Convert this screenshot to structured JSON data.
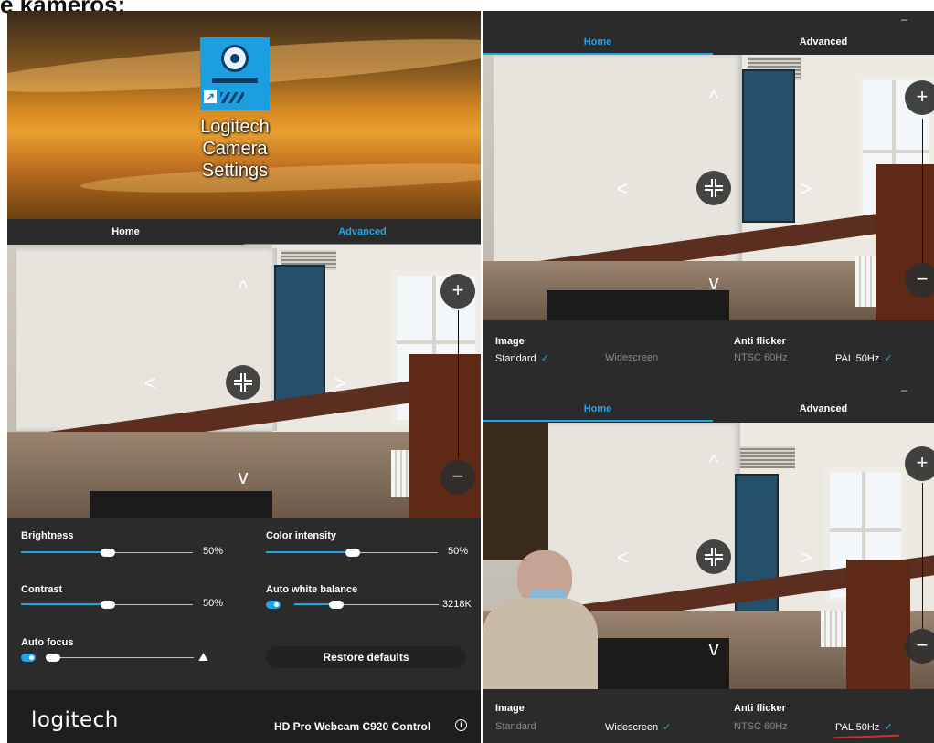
{
  "heading": "e kameros:",
  "desktop": {
    "icon_label": "Logitech Camera Settings"
  },
  "tabs": {
    "home": "Home",
    "advanced": "Advanced"
  },
  "controls": {
    "brightness": {
      "label": "Brightness",
      "value": "50%",
      "level": 0.5
    },
    "contrast": {
      "label": "Contrast",
      "value": "50%",
      "level": 0.5
    },
    "auto_focus": {
      "label": "Auto focus",
      "enabled": true
    },
    "color_intensity": {
      "label": "Color intensity",
      "value": "50%",
      "level": 0.5
    },
    "auto_white_balance": {
      "label": "Auto white balance",
      "value": "3218K",
      "enabled": true,
      "level": 0.3
    },
    "restore_label": "Restore defaults"
  },
  "footer": {
    "brand": "logitech",
    "model": "HD Pro Webcam C920 Control",
    "info_icon": "info-icon"
  },
  "image_options": {
    "image_title": "Image",
    "standard": "Standard",
    "widescreen": "Widescreen",
    "anti_flicker_title": "Anti flicker",
    "ntsc": "NTSC 60Hz",
    "pal": "PAL 50Hz",
    "check": "✓"
  },
  "window": {
    "minimize": "–"
  },
  "overlay": {
    "up": "^",
    "down": "v",
    "left": "<",
    "right": ">",
    "zoom_in": "+",
    "zoom_out": "−"
  },
  "colors": {
    "accent": "#20a6e8",
    "panel": "#2b2b2b"
  }
}
